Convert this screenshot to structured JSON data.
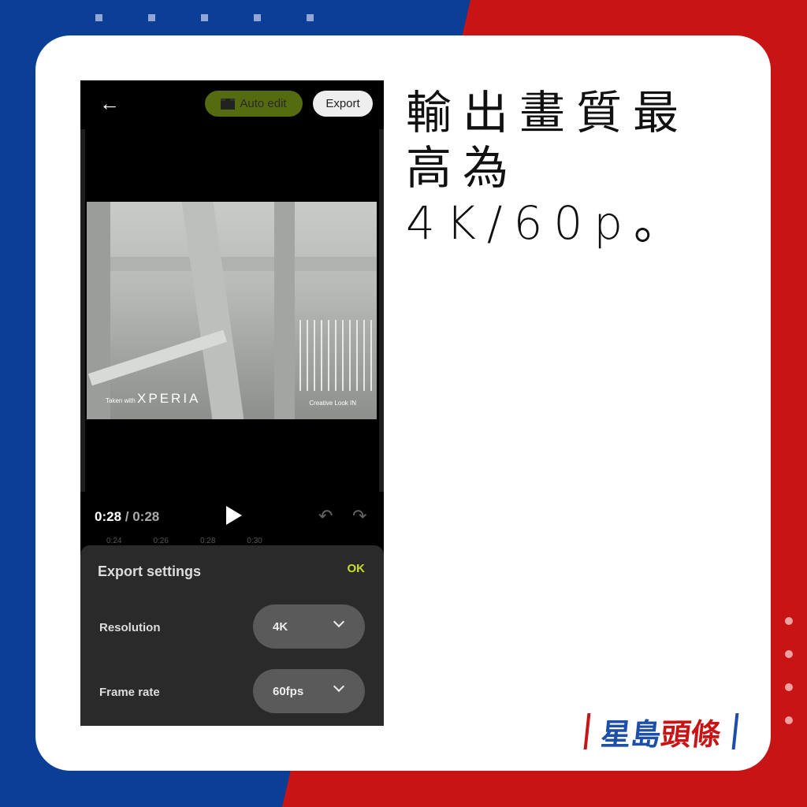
{
  "headline": "輸出畫質最高為4K/60p。",
  "app": {
    "back_icon": "arrow-left-icon",
    "auto_edit_label": "Auto edit",
    "export_label": "Export",
    "accent": "#c8e021"
  },
  "video": {
    "watermark_left_prefix": "Taken with",
    "watermark_left_brand": "XPERIA",
    "watermark_right": "Creative Look IN"
  },
  "player": {
    "current_time": "0:28",
    "separator": " / ",
    "total_time": "0:28",
    "timeline_ticks": [
      "0:24",
      "0:26",
      "0:28",
      "0:30"
    ]
  },
  "export_settings": {
    "title": "Export settings",
    "ok_label": "OK",
    "rows": [
      {
        "label": "Resolution",
        "value": "4K"
      },
      {
        "label": "Frame rate",
        "value": "60fps"
      }
    ]
  },
  "logo": {
    "text_blue": "星島",
    "text_red": "頭條"
  }
}
